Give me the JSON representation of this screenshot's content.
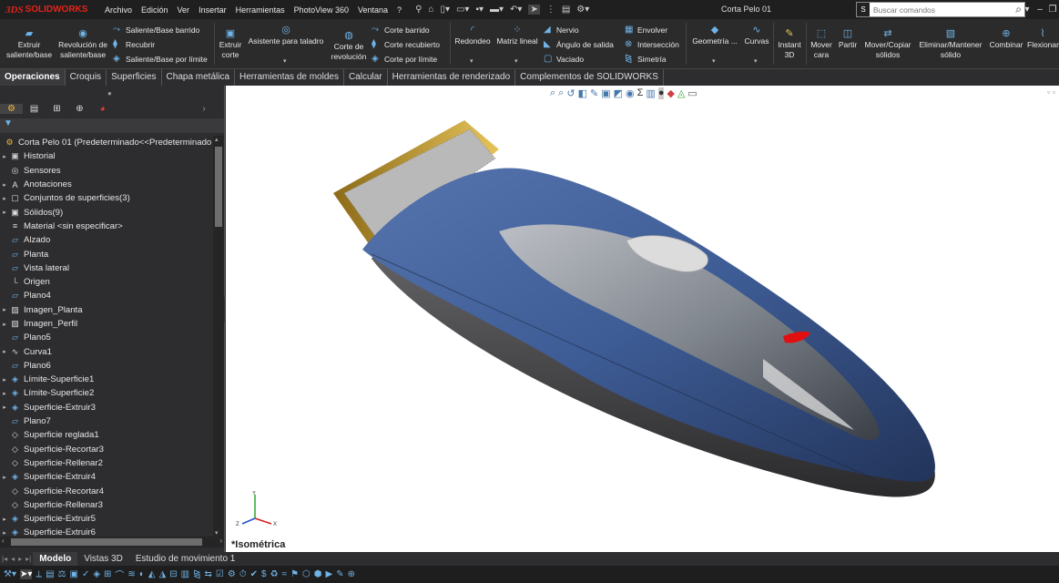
{
  "brand": {
    "ds": "3DS",
    "name": "SOLIDWORKS"
  },
  "menu": [
    "Archivo",
    "Edición",
    "Ver",
    "Insertar",
    "Herramientas",
    "PhotoView 360",
    "Ventana",
    "?"
  ],
  "doc_title": "Corta Pelo 01",
  "search": {
    "placeholder": "Buscar comandos"
  },
  "ribbon": {
    "extrude_boss": "Extruir saliente/base",
    "revolve_boss": "Revolución de saliente/base",
    "sweep_boss": "Saliente/Base barrido",
    "loft_boss": "Recubrir",
    "boundary_boss": "Saliente/Base por límite",
    "extrude_cut": "Extruir corte",
    "hole_wizard": "Asistente para taladro",
    "revolve_cut": "Corte de revolución",
    "sweep_cut": "Corte barrido",
    "loft_cut": "Corte recubierto",
    "boundary_cut": "Corte por límite",
    "fillet": "Redondeo",
    "linear_pattern": "Matriz lineal",
    "rib": "Nervio",
    "draft": "Ángulo de salida",
    "shell": "Vaciado",
    "wrap": "Envolver",
    "intersect": "Intersección",
    "mirror": "Simetría",
    "ref_geometry": "Geometría ...",
    "curves": "Curvas",
    "instant3d": "Instant 3D",
    "move_face": "Mover cara",
    "split": "Partir",
    "move_copy": "Mover/Copiar sólidos",
    "delete_keep": "Eliminar/Mantener sólido",
    "combine": "Combinar",
    "flex": "Flexionar"
  },
  "tabs": [
    {
      "label": "Operaciones",
      "active": true
    },
    {
      "label": "Croquis",
      "active": false
    },
    {
      "label": "Superficies",
      "active": false
    },
    {
      "label": "Chapa metálica",
      "active": false
    },
    {
      "label": "Herramientas de moldes",
      "active": false
    },
    {
      "label": "Calcular",
      "active": false
    },
    {
      "label": "Herramientas de renderizado",
      "active": false
    },
    {
      "label": "Complementos de SOLIDWORKS",
      "active": false
    }
  ],
  "tree": {
    "root": "Corta Pelo 01  (Predeterminado<<Predeterminado",
    "items": [
      {
        "label": "Historial",
        "icon": "history-icon",
        "expand": true
      },
      {
        "label": "Sensores",
        "icon": "sensor-icon",
        "expand": false
      },
      {
        "label": "Anotaciones",
        "icon": "annotation-icon",
        "expand": true
      },
      {
        "label": "Conjuntos de superficies(3)",
        "icon": "surface-bodies-icon",
        "expand": true
      },
      {
        "label": "Sólidos(9)",
        "icon": "solid-bodies-icon",
        "expand": true
      },
      {
        "label": "Material <sin especificar>",
        "icon": "material-icon",
        "expand": false
      },
      {
        "label": "Alzado",
        "icon": "plane-icon",
        "expand": false
      },
      {
        "label": "Planta",
        "icon": "plane-icon",
        "expand": false
      },
      {
        "label": "Vista lateral",
        "icon": "plane-icon",
        "expand": false
      },
      {
        "label": "Origen",
        "icon": "origin-icon",
        "expand": false
      },
      {
        "label": "Plano4",
        "icon": "plane-icon",
        "expand": false
      },
      {
        "label": "Imagen_Planta",
        "icon": "sketch-picture-icon",
        "expand": true
      },
      {
        "label": "Imagen_Perfil",
        "icon": "sketch-picture-icon",
        "expand": true
      },
      {
        "label": "Plano5",
        "icon": "plane-icon",
        "expand": false
      },
      {
        "label": "Curva1",
        "icon": "curve-icon",
        "expand": true
      },
      {
        "label": "Plano6",
        "icon": "plane-icon",
        "expand": false
      },
      {
        "label": "Límite-Superficie1",
        "icon": "boundary-surface-icon",
        "expand": true
      },
      {
        "label": "Límite-Superficie2",
        "icon": "boundary-surface-icon",
        "expand": true
      },
      {
        "label": "Superficie-Extruir3",
        "icon": "extruded-surface-icon",
        "expand": true
      },
      {
        "label": "Plano7",
        "icon": "plane-icon",
        "expand": false
      },
      {
        "label": "Superficie reglada1",
        "icon": "ruled-surface-icon",
        "expand": false
      },
      {
        "label": "Superficie-Recortar3",
        "icon": "trim-surface-icon",
        "expand": false
      },
      {
        "label": "Superficie-Rellenar2",
        "icon": "fill-surface-icon",
        "expand": false
      },
      {
        "label": "Superficie-Extruir4",
        "icon": "extruded-surface-icon",
        "expand": true
      },
      {
        "label": "Superficie-Recortar4",
        "icon": "trim-surface-icon",
        "expand": false
      },
      {
        "label": "Superficie-Rellenar3",
        "icon": "fill-surface-icon",
        "expand": false
      },
      {
        "label": "Superficie-Extruir5",
        "icon": "extruded-surface-icon",
        "expand": true
      },
      {
        "label": "Superficie-Extruir6",
        "icon": "extruded-surface-icon",
        "expand": true
      }
    ]
  },
  "viewport": {
    "view_label": "*Isométrica",
    "model_colors": {
      "body": "#3d5b94",
      "blade": "#c9a23a",
      "accent": "#e01010"
    }
  },
  "bottom_tabs": [
    {
      "label": "Modelo",
      "active": true
    },
    {
      "label": "Vistas 3D",
      "active": false
    },
    {
      "label": "Estudio de movimiento 1",
      "active": false
    }
  ]
}
